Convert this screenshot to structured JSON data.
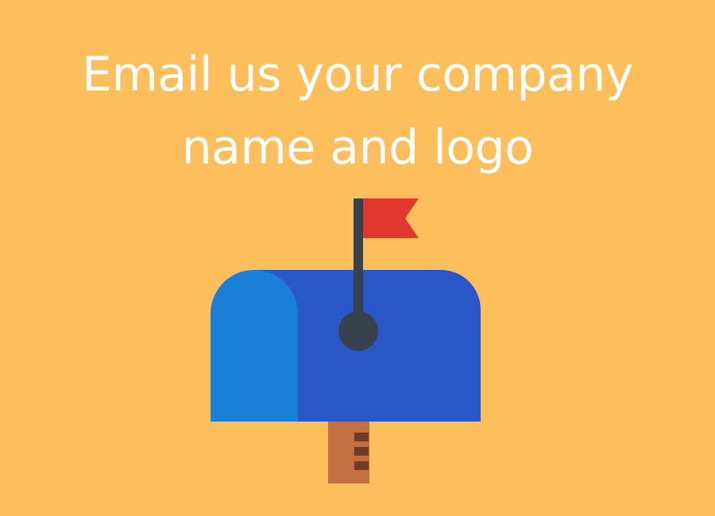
{
  "headline": {
    "line1": "Email us your company",
    "line2": "name and logo"
  },
  "illustration": {
    "icon": "mailbox-icon",
    "colors": {
      "background": "#FDBE5C",
      "text": "#FFFFFF",
      "mailbox_body": "#2A57C8",
      "mailbox_door": "#1A7FD8",
      "flag": "#E0382E",
      "flag_pole": "#37424F",
      "post": "#C46F42",
      "post_notches": "#6B3E24"
    }
  }
}
